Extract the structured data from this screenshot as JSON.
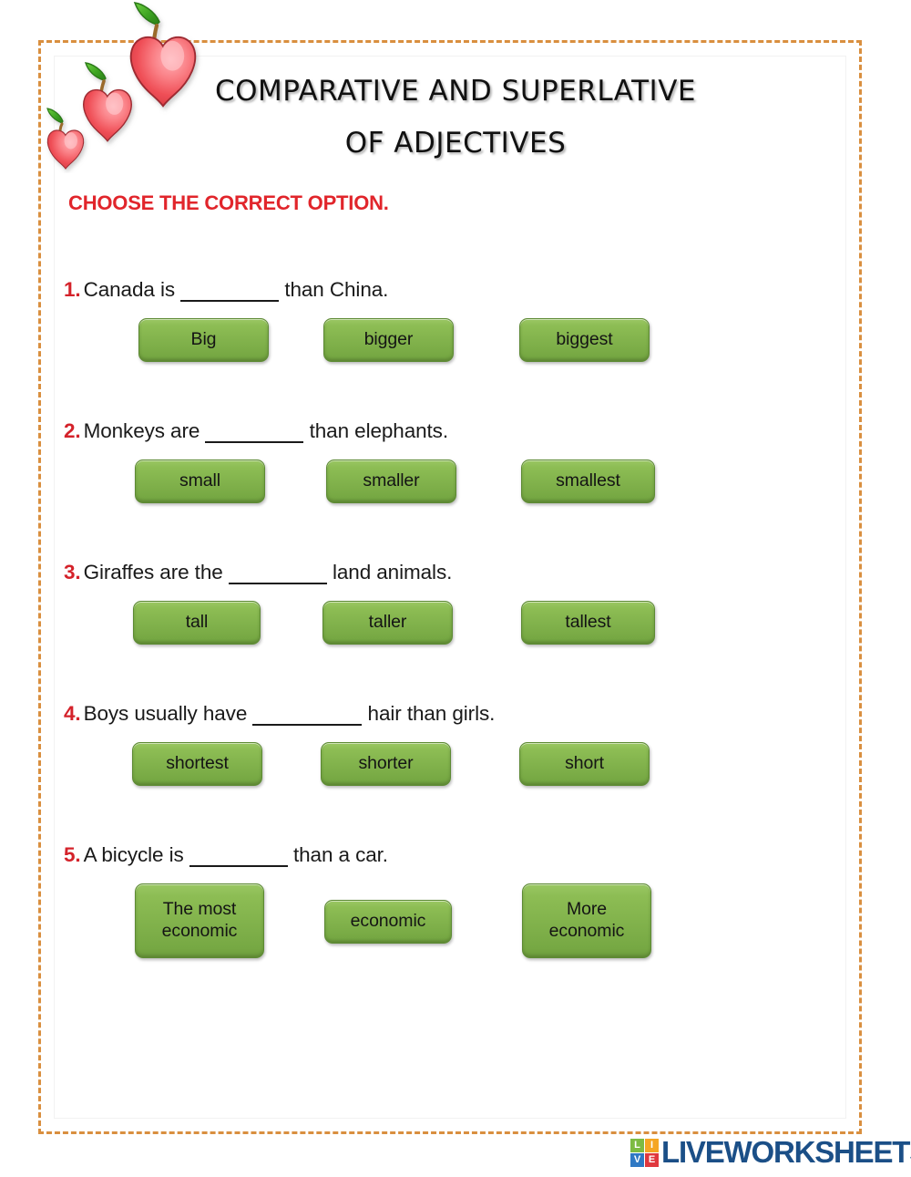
{
  "worksheet": {
    "title_line_1": "COMPARATIVE AND SUPERLATIVE",
    "title_line_2": "OF ADJECTIVES",
    "instruction": "CHOOSE THE CORRECT OPTION.",
    "decoration": "three-apples",
    "colors": {
      "border": "#d98f3f",
      "instruction_red": "#e1252b",
      "number_red": "#d4222a",
      "button_green": "#7fb04a",
      "button_border_green": "#5d8a34",
      "logo_navy": "#1b4f87"
    }
  },
  "questions": [
    {
      "number": "1.",
      "text_before": "Canada is",
      "blank": "_______",
      "text_after": "than China.",
      "options": [
        "Big",
        "bigger",
        "biggest"
      ]
    },
    {
      "number": "2.",
      "text_before": "Monkeys are",
      "blank": "_______",
      "text_after": "than elephants.",
      "options": [
        "small",
        "smaller",
        "smallest"
      ]
    },
    {
      "number": "3.",
      "text_before": "Giraffes are the",
      "blank": "_______",
      "text_after": "land animals.",
      "options": [
        "tall",
        "taller",
        "tallest"
      ]
    },
    {
      "number": "4.",
      "text_before": "Boys usually have",
      "blank": "________",
      "text_after": "hair than girls.",
      "options": [
        "shortest",
        "shorter",
        "short"
      ]
    },
    {
      "number": "5.",
      "text_before": "A bicycle is",
      "blank": "_______",
      "text_after": "than a car.",
      "options": [
        "The most economic",
        "economic",
        "More economic"
      ]
    }
  ],
  "footer": {
    "logo_tiles": [
      "L",
      "I",
      "V",
      "E"
    ],
    "wordmark": "LIVEWORKSHEETS"
  }
}
